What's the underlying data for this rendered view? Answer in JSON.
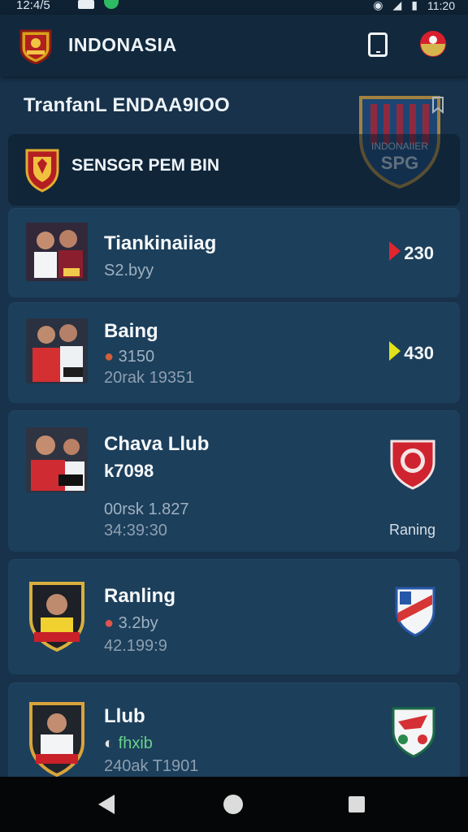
{
  "status_bar": {
    "time_left": "12:4/5",
    "time_right": "11:20",
    "icons": [
      "box-icon",
      "leaf-icon",
      "wifi-icon",
      "signal-icon",
      "battery-icon"
    ]
  },
  "app_bar": {
    "title": "INDONASIA",
    "icons": [
      "club-logo-icon",
      "tablet-icon",
      "flag-emblem-icon"
    ]
  },
  "section": {
    "title": "TranfanL ENDAA9IOO",
    "crest_text_top": "INDONAIIER",
    "crest_text_bottom": "SPG"
  },
  "header_card": {
    "label": "SENSGR PEM BIN"
  },
  "cards": [
    {
      "title": "Tiankinaiiag",
      "meta": "S2.byy",
      "count": "230",
      "indicator": "red-arrow"
    },
    {
      "title": "Baing",
      "meta": "3150",
      "meta2": "20rak 19351",
      "count": "430",
      "indicator": "yellow-arrow"
    },
    {
      "title": "Chava Llub",
      "subtitle": "k7098",
      "meta": "00rsk 1.827",
      "meta2": "34:39:30",
      "bottom_label": "Raning"
    },
    {
      "title": "Ranling",
      "meta": "3.2by",
      "meta2": "42.199:9"
    },
    {
      "title": "Llub",
      "meta": "fhxib",
      "meta2": "240ak T1901"
    }
  ],
  "colors": {
    "background": "#17324a",
    "card": "#1c3f5b",
    "accent_red": "#e2242f",
    "accent_yellow": "#e2e11a",
    "navbar": "#050607"
  }
}
